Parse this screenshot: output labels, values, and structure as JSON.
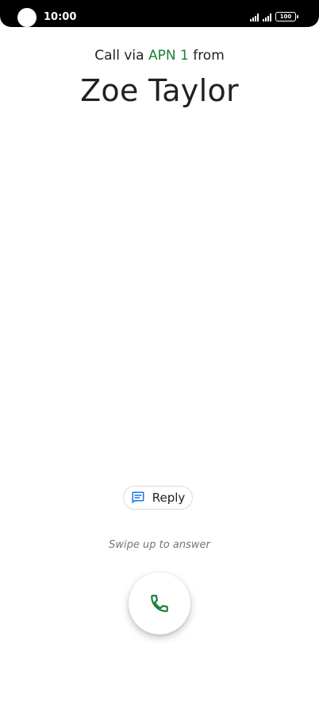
{
  "status_bar": {
    "time": "10:00",
    "battery": "100"
  },
  "call": {
    "via_prefix": "Call via",
    "apn_name": "APN 1",
    "via_suffix": "from",
    "caller_name": "Zoe Taylor"
  },
  "actions": {
    "reply_label": "Reply",
    "swipe_hint": "Swipe up to answer"
  },
  "colors": {
    "apn_accent": "#188038",
    "answer_icon": "#188038",
    "reply_icon": "#1a73e8"
  },
  "icons": {
    "reply": "message-icon",
    "answer": "phone-icon"
  }
}
